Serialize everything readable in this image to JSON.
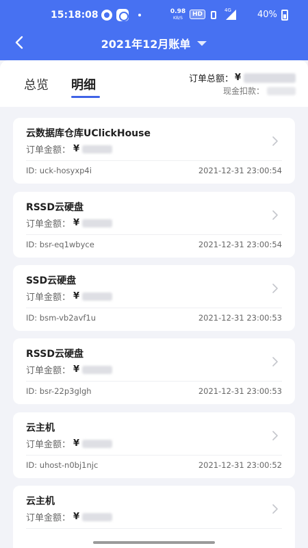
{
  "status_bar": {
    "time": "15:18:08",
    "speed_value": "0.98",
    "speed_unit": "KB/S",
    "hd_label": "HD",
    "signal_label": "4G",
    "battery": "40%"
  },
  "nav": {
    "title": "2021年12月账单",
    "back_icon": "chevron-left-icon",
    "dropdown_icon": "caret-down-icon"
  },
  "tabs": [
    {
      "label": "总览",
      "active": false
    },
    {
      "label": "明细",
      "active": true
    }
  ],
  "summary": {
    "total_label": "订单总额：",
    "currency": "¥",
    "cash_label": "现金扣款："
  },
  "orders": [
    {
      "name": "云数据库仓库UClickHouse",
      "amount_label": "订单金额：",
      "currency": "¥",
      "id": "ID: uck-hosyxp4i",
      "time": "2021-12-31 23:00:54"
    },
    {
      "name": "RSSD云硬盘",
      "amount_label": "订单金额：",
      "currency": "¥",
      "id": "ID: bsr-eq1wbyce",
      "time": "2021-12-31 23:00:54"
    },
    {
      "name": "SSD云硬盘",
      "amount_label": "订单金额：",
      "currency": "¥",
      "id": "ID: bsm-vb2avf1u",
      "time": "2021-12-31 23:00:53"
    },
    {
      "name": "RSSD云硬盘",
      "amount_label": "订单金额：",
      "currency": "¥",
      "id": "ID: bsr-22p3glgh",
      "time": "2021-12-31 23:00:53"
    },
    {
      "name": "云主机",
      "amount_label": "订单金额：",
      "currency": "¥",
      "id": "ID: uhost-n0bj1njc",
      "time": "2021-12-31 23:00:52"
    },
    {
      "name": "云主机",
      "amount_label": "订单金额：",
      "currency": "¥",
      "id": "",
      "time": ""
    }
  ],
  "colors": {
    "header_bg": "#4771f2",
    "accent": "#3f63e6",
    "page_bg": "#f2f3f8"
  }
}
